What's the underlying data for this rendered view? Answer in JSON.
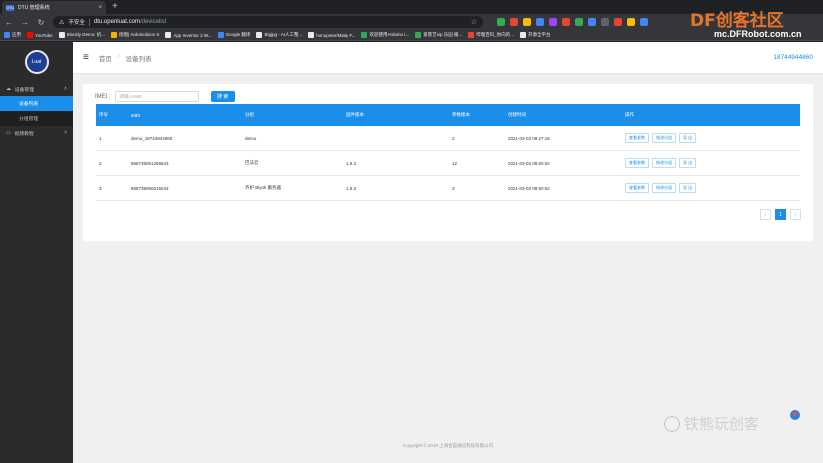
{
  "browser": {
    "tab_title": "DTU 管理系统",
    "tab_favicon": "DTU",
    "close_tab": "×",
    "new_tab": "+",
    "security_label": "不安全",
    "url_host": "dtu.openluat.com",
    "url_path": "/devicelist",
    "bookmarks": [
      {
        "label": "应用",
        "color": "#4285f4"
      },
      {
        "label": "YouTube",
        "color": "#ff0000"
      },
      {
        "label": "Blockly Demo: 机...",
        "color": "#e8eaed"
      },
      {
        "label": "街图| Arduinolsion S",
        "color": "#f4b400"
      },
      {
        "label": "App Inventor 2 W...",
        "color": "#e8eaed"
      },
      {
        "label": "Google 翻译",
        "color": "#4285f4"
      },
      {
        "label": "Bigjpg - AI人工整...",
        "color": "#e8eaed"
      },
      {
        "label": "honupeter/Mialy F...",
        "color": "#e8eaed"
      },
      {
        "label": "欢迎使用Arduino I...",
        "color": "#34a853"
      },
      {
        "label": "爱客艺vip 乐园 搬...",
        "color": "#34a853"
      },
      {
        "label": "哔哩百科_你向的...",
        "color": "#ea4335"
      },
      {
        "label": "开源全平台",
        "color": "#e8eaed"
      }
    ],
    "extension_colors": [
      "#34a853",
      "#ea4335",
      "#fbbc05",
      "#4285f4",
      "#a142f4",
      "#ea4335",
      "#34a853",
      "#4285f4",
      "#5f6368",
      "#ea4335",
      "#fbbc05",
      "#4285f4"
    ]
  },
  "sidebar": {
    "logo_text": "Luat",
    "group_label": "设备管理",
    "items": [
      {
        "label": "设备列表",
        "active": true
      },
      {
        "label": "分组管理",
        "active": false
      }
    ],
    "group2_label": "视频教程"
  },
  "header": {
    "breadcrumb": [
      "首页",
      "设备列表"
    ],
    "separator": "/",
    "user": "18744944860"
  },
  "search": {
    "label": "IMEI :",
    "placeholder": "请输入IMEI",
    "button": "搜 索"
  },
  "table": {
    "columns": [
      "序号",
      "IMEI",
      "分组",
      "固件版本",
      "参数版本",
      "创建时间",
      "操作"
    ],
    "rows": [
      {
        "index": "1",
        "imei": "demo_18744944860",
        "group": "demo",
        "firmware": "",
        "param": "2",
        "created": "2021-03-03 09:27:16"
      },
      {
        "index": "2",
        "imei": "868739051266843",
        "group": "巴法云",
        "firmware": "1.9.3",
        "param": "12",
        "created": "2021-03-03 09:50:52"
      },
      {
        "index": "3",
        "imei": "868739050615043",
        "group": "齐护 Blynk 服务器",
        "firmware": "1.9.3",
        "param": "3",
        "created": "2021-03-03 09:50:52"
      }
    ],
    "actions": [
      "查看参数",
      "修改分组",
      "导 出"
    ]
  },
  "pagination": {
    "prev": "‹",
    "current": "1",
    "next": "›"
  },
  "footer": "Copyright © 2018 上海合宙通信科技有限公司",
  "watermarks": {
    "brand": "DF创客社区",
    "url": "mc.DFRobot.com.cn",
    "wechat": "铁熊玩创客"
  }
}
